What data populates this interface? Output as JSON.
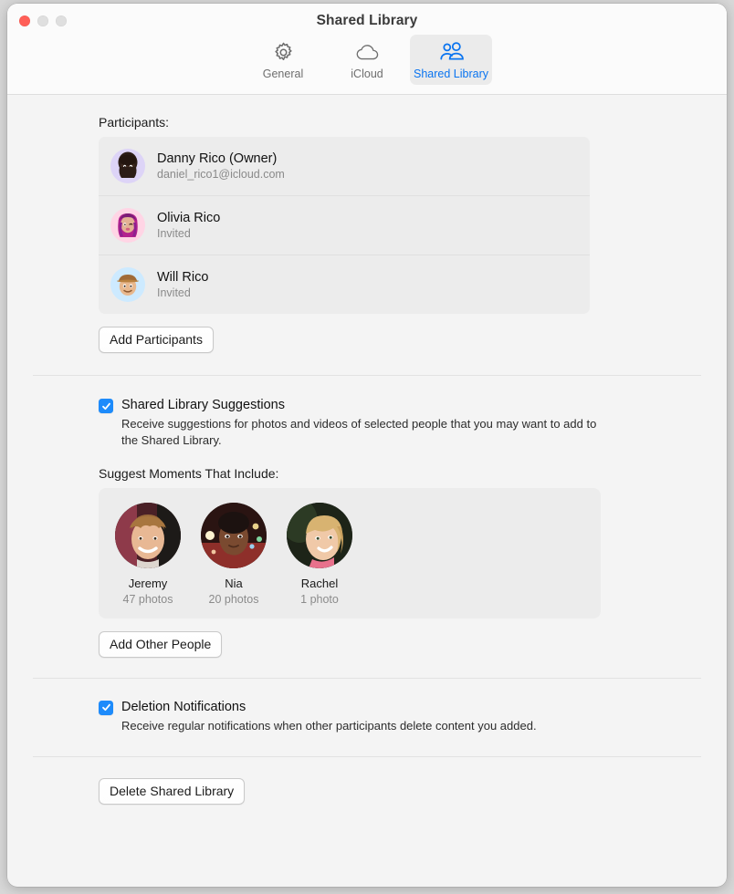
{
  "window": {
    "title": "Shared Library",
    "traffic_lights": [
      "close-button",
      "minimize-button",
      "zoom-button"
    ]
  },
  "toolbar": {
    "tabs": [
      {
        "label": "General",
        "icon": "gear-icon",
        "selected": false
      },
      {
        "label": "iCloud",
        "icon": "cloud-icon",
        "selected": false
      },
      {
        "label": "Shared Library",
        "icon": "people-icon",
        "selected": true
      }
    ]
  },
  "participants_section": {
    "label": "Participants:",
    "rows": [
      {
        "name": "Danny Rico (Owner)",
        "sub": "daniel_rico1@icloud.com",
        "avatar": "memoji-danny"
      },
      {
        "name": "Olivia Rico",
        "sub": "Invited",
        "avatar": "memoji-olivia"
      },
      {
        "name": "Will Rico",
        "sub": "Invited",
        "avatar": "memoji-will"
      }
    ],
    "add_button": "Add Participants"
  },
  "suggestions_section": {
    "checkbox_label": "Shared Library Suggestions",
    "checkbox_checked": true,
    "description": "Receive suggestions for photos and videos of selected people that you may want to add to the Shared Library.",
    "moments_label": "Suggest Moments That Include:",
    "people": [
      {
        "name": "Jeremy",
        "count": "47 photos"
      },
      {
        "name": "Nia",
        "count": "20 photos"
      },
      {
        "name": "Rachel",
        "count": "1 photo"
      }
    ],
    "add_button": "Add Other People"
  },
  "deletion_section": {
    "checkbox_label": "Deletion Notifications",
    "checkbox_checked": true,
    "description": "Receive regular notifications when other participants delete content you added."
  },
  "footer": {
    "delete_button": "Delete Shared Library"
  },
  "colors": {
    "accent_blue": "#0a74f0",
    "checkbox_blue": "#1d8bfb",
    "close_red": "#ff5f57",
    "window_bg": "#f4f4f4",
    "group_bg": "#ececec"
  }
}
